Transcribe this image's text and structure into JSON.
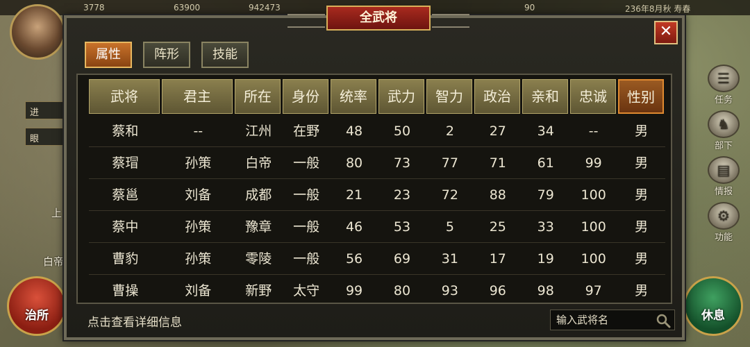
{
  "top_bar": {
    "resource_a": "3778",
    "resource_b": "63900",
    "resource_c": "942473",
    "resource_d": "90",
    "date_text": "236年8月秋 寿春"
  },
  "left_panel": {
    "btn_1": "进",
    "btn_2": "眼",
    "map_labels": [
      "上",
      "白帝"
    ]
  },
  "bottom_buttons": {
    "govern": "治所",
    "rest": "休息"
  },
  "side_menu": [
    {
      "label": "任务",
      "icon": "task-icon"
    },
    {
      "label": "部下",
      "icon": "subordinates-icon"
    },
    {
      "label": "情报",
      "icon": "intel-icon"
    },
    {
      "label": "功能",
      "icon": "function-icon"
    }
  ],
  "modal": {
    "title": "全武将",
    "close_label": "✕",
    "tabs": [
      {
        "label": "属性",
        "active": true
      },
      {
        "label": "阵形",
        "active": false
      },
      {
        "label": "技能",
        "active": false
      }
    ],
    "columns": [
      "武将",
      "君主",
      "所在",
      "身份",
      "统率",
      "武力",
      "智力",
      "政治",
      "亲和",
      "忠诚",
      "性别"
    ],
    "active_sort_column": "性别",
    "rows": [
      [
        "蔡和",
        "--",
        "江州",
        "在野",
        "48",
        "50",
        "2",
        "27",
        "34",
        "--",
        "男"
      ],
      [
        "蔡瑁",
        "孙策",
        "白帝",
        "一般",
        "80",
        "73",
        "77",
        "71",
        "61",
        "99",
        "男"
      ],
      [
        "蔡邕",
        "刘备",
        "成都",
        "一般",
        "21",
        "23",
        "72",
        "88",
        "79",
        "100",
        "男"
      ],
      [
        "蔡中",
        "孙策",
        "豫章",
        "一般",
        "46",
        "53",
        "5",
        "25",
        "33",
        "100",
        "男"
      ],
      [
        "曹豹",
        "孙策",
        "零陵",
        "一般",
        "56",
        "69",
        "31",
        "17",
        "19",
        "100",
        "男"
      ],
      [
        "曹操",
        "刘备",
        "新野",
        "太守",
        "99",
        "80",
        "93",
        "96",
        "98",
        "97",
        "男"
      ]
    ],
    "hint": "点击查看详细信息",
    "search": {
      "placeholder": "输入武将名",
      "value": ""
    }
  },
  "colors": {
    "accent_red": "#a82a1e",
    "tab_active": "#c8722a",
    "header_gold": "#8a7f4e"
  }
}
